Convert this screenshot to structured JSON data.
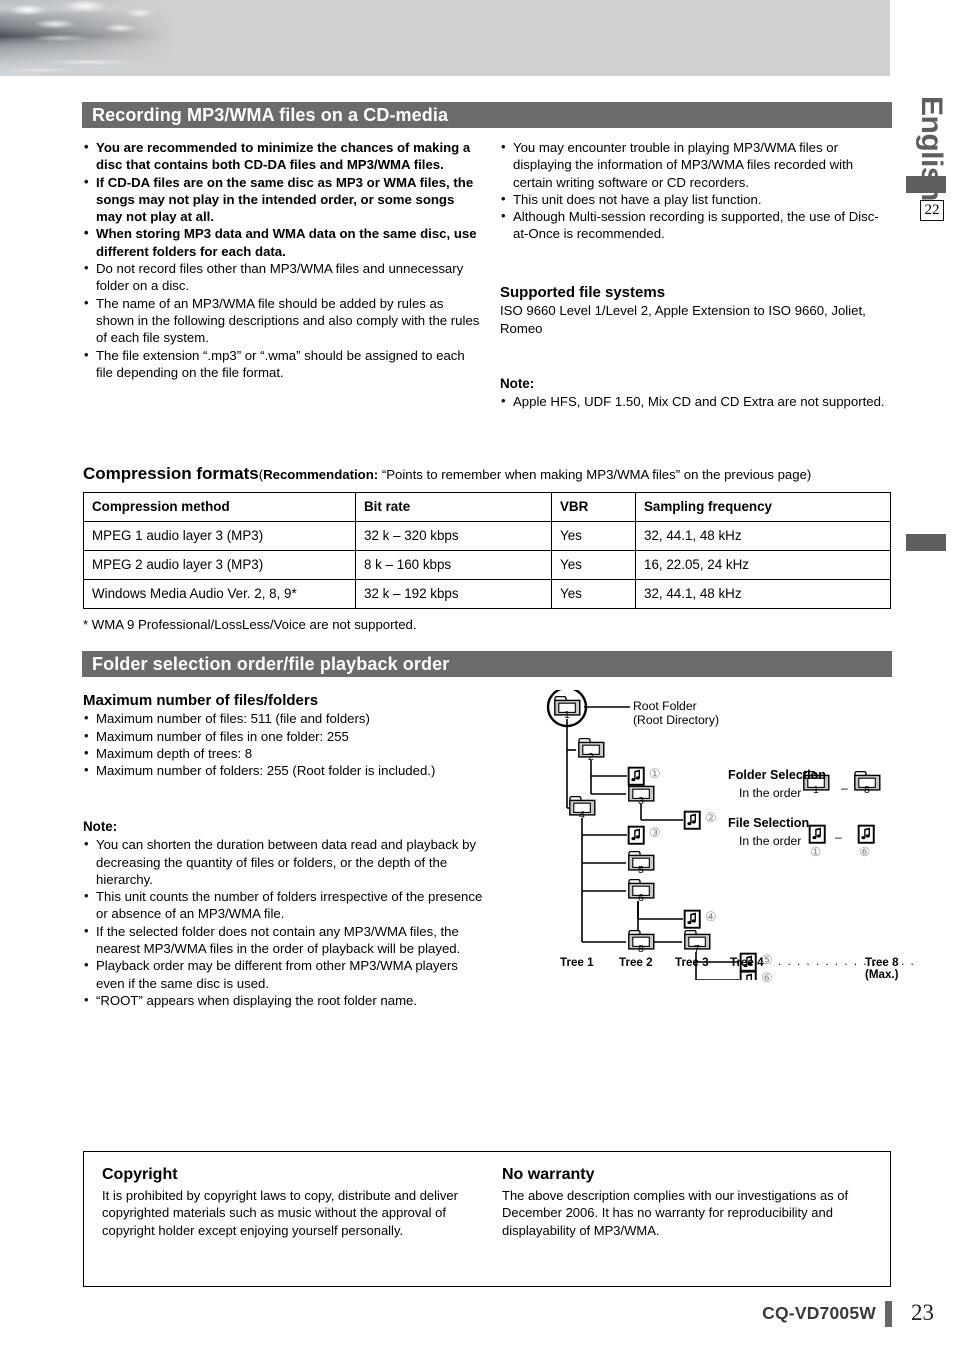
{
  "page": {
    "language_tab": "English",
    "page_chip": "22",
    "model": "CQ-VD7005W",
    "page_number": "23"
  },
  "section1": {
    "title": "Recording MP3/WMA files on a CD-media",
    "left_bullets": [
      {
        "text": "You are recommended to minimize the chances of making a disc that contains both CD-DA files and MP3/WMA files.",
        "bold": true
      },
      {
        "text": "If CD-DA files are on the same disc as MP3 or WMA files, the songs may not play in the intended order, or some songs may not play at all.",
        "bold": true
      },
      {
        "text": "When storing MP3 data and WMA data on the same disc, use different folders for each data.",
        "bold": true
      },
      {
        "text": "Do not record files other than MP3/WMA files and unnecessary folder on a disc.",
        "bold": false
      },
      {
        "text": "The name of an MP3/WMA file should be added by rules as shown in the following descriptions and also comply with the rules of each file system.",
        "bold": false
      },
      {
        "text": "The file extension “.mp3” or “.wma” should be assigned to each file depending on the file format.",
        "bold": false
      }
    ],
    "right_bullets": [
      "You may encounter trouble in playing MP3/WMA files or displaying the information of MP3/WMA files recorded with certain writing software or CD recorders.",
      "This unit does not have a play list function.",
      "Although Multi-session recording is supported, the use of Disc-at-Once is recommended."
    ],
    "supported_heading": "Supported file systems",
    "supported_text": "ISO 9660 Level 1/Level 2, Apple Extension to ISO 9660, Joliet, Romeo",
    "note_heading": "Note:",
    "note_bullets": [
      "Apple HFS, UDF 1.50, Mix CD and CD Extra are not supported."
    ]
  },
  "compression": {
    "heading": "Compression formats",
    "subheading_label": "Recommendation:",
    "subheading_rest": " “Points to remember when making MP3/WMA files” on the previous page)",
    "paren_open": "(",
    "columns": [
      "Compression method",
      "Bit rate",
      "VBR",
      "Sampling frequency"
    ],
    "rows": [
      [
        "MPEG 1 audio layer 3 (MP3)",
        "32 k – 320 kbps",
        "Yes",
        "32, 44.1, 48 kHz"
      ],
      [
        "MPEG 2 audio layer 3 (MP3)",
        "8 k – 160 kbps",
        "Yes",
        "16, 22.05, 24 kHz"
      ],
      [
        "Windows Media Audio Ver. 2, 8, 9*",
        "32 k – 192 kbps",
        "Yes",
        "32, 44.1, 48 kHz"
      ]
    ],
    "footnote": "* WMA 9 Professional/LossLess/Voice are not supported."
  },
  "section2": {
    "title": "Folder selection order/file playback order",
    "max_heading": "Maximum number of files/folders",
    "max_bullets": [
      "Maximum number of files: 511 (file and folders)",
      "Maximum number of files in one folder: 255",
      "Maximum depth of trees: 8",
      "Maximum number of folders: 255 (Root folder is included.)"
    ],
    "note_heading": "Note:",
    "note_bullets": [
      "You can shorten the duration between data read and playback by decreasing the quantity of files or folders, or the depth of the hierarchy.",
      "This unit counts the number of folders irrespective of the presence or absence of an MP3/WMA file.",
      "If the selected folder does not contain any MP3/WMA files, the nearest MP3/WMA files in the order of playback will be played.",
      "Playback order may be different from other MP3/WMA players even if the same disc is used.",
      "“ROOT” appears when displaying the root folder name."
    ]
  },
  "diagram": {
    "root_label_line1": "Root Folder",
    "root_label_line2": "(Root Directory)",
    "folder_selection_title": "Folder Selection",
    "folder_selection_text": "In the order",
    "folder_from": "1",
    "folder_dash": "–",
    "folder_to": "8",
    "file_selection_title": "File Selection",
    "file_selection_text": "In the order",
    "file_from": "①",
    "file_dash": "–",
    "file_to": "⑥",
    "folders": [
      "1",
      "2",
      "3",
      "4",
      "5",
      "6",
      "7",
      "8"
    ],
    "files": [
      "①",
      "②",
      "③",
      "④",
      "⑤",
      "⑥"
    ],
    "tree_labels": [
      "Tree 1",
      "Tree 2",
      "Tree 3",
      "Tree 4",
      "Tree 8"
    ],
    "tree_max_note": "(Max.)",
    "dots": ". . . . . . . . . . . . . . ."
  },
  "bottom": {
    "copyright_heading": "Copyright",
    "copyright_text": "It is prohibited by copyright laws to copy, distribute and deliver copyrighted materials such as music without the approval of copyright holder except enjoying yourself personally.",
    "warranty_heading": "No warranty",
    "warranty_text": "The above description complies with our investigations as of December 2006. It has no warranty for reproducibility and displayability of MP3/WMA."
  }
}
